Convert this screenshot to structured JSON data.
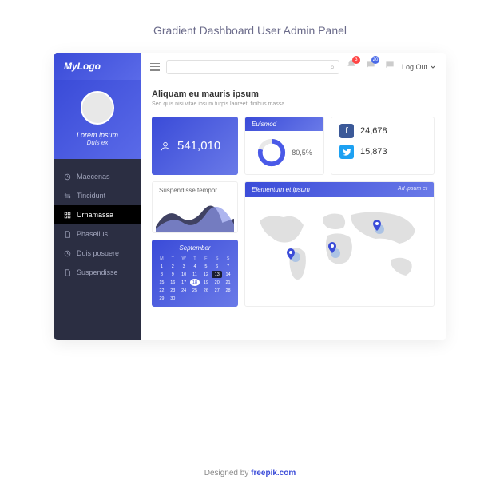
{
  "page_title": "Gradient Dashboard User Admin Panel",
  "logo": "MyLogo",
  "profile": {
    "name": "Lorem ipsum",
    "sub": "Duis ex"
  },
  "nav": [
    {
      "icon": "clock",
      "label": "Maecenas"
    },
    {
      "icon": "arrows",
      "label": "Tincidunt"
    },
    {
      "icon": "grid",
      "label": "Urnamassa"
    },
    {
      "icon": "file",
      "label": "Phasellus"
    },
    {
      "icon": "clock",
      "label": "Duis posuere"
    },
    {
      "icon": "file",
      "label": "Suspendisse"
    }
  ],
  "active_nav": 2,
  "notifications": [
    {
      "color": "red",
      "count": 3
    },
    {
      "color": "blue",
      "count": 20
    },
    {
      "color": "none",
      "count": null
    }
  ],
  "logout": "Log Out",
  "content": {
    "title": "Aliquam eu mauris ipsum",
    "subtitle": "Sed quis nisi vitae ipsum turpis laoreet, finibus massa."
  },
  "stat": {
    "value": "541,010"
  },
  "gauge": {
    "title": "Euismod",
    "pct": "80,5%"
  },
  "social": {
    "facebook": "24,678",
    "twitter": "15,873"
  },
  "area": {
    "title": "Suspendisse tempor"
  },
  "map": {
    "title": "Elementum et ipsum",
    "sub": "Ad ipsum et"
  },
  "calendar": {
    "month": "September",
    "dow": [
      "M",
      "T",
      "W",
      "T",
      "F",
      "S",
      "S"
    ],
    "days": [
      1,
      2,
      3,
      4,
      5,
      6,
      7,
      8,
      9,
      10,
      11,
      12,
      13,
      14,
      15,
      16,
      17,
      18,
      19,
      20,
      21,
      22,
      23,
      24,
      25,
      26,
      27,
      28,
      29,
      30
    ],
    "today": 18,
    "dark": 13
  },
  "chart_data": [
    {
      "type": "gauge",
      "title": "Euismod",
      "value": 80.5,
      "max": 100
    },
    {
      "type": "area",
      "title": "Suspendisse tempor",
      "series": [
        {
          "name": "dark",
          "values": [
            10,
            25,
            45,
            30,
            20,
            35,
            15
          ]
        },
        {
          "name": "light",
          "values": [
            5,
            30,
            20,
            40,
            25,
            15,
            30
          ]
        }
      ],
      "x": [
        0,
        1,
        2,
        3,
        4,
        5,
        6
      ],
      "ylim": [
        0,
        50
      ]
    }
  ],
  "footer": {
    "pre": "Designed by ",
    "brand": "freepik.com"
  }
}
